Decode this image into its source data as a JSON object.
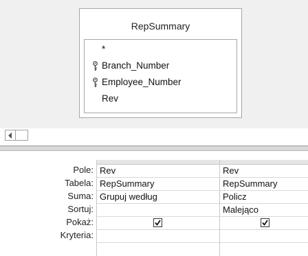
{
  "table": {
    "name": "RepSummary",
    "fields": [
      {
        "name": "*",
        "key": false
      },
      {
        "name": "Branch_Number",
        "key": true
      },
      {
        "name": "Employee_Number",
        "key": true
      },
      {
        "name": "Rev",
        "key": false
      }
    ]
  },
  "grid": {
    "row_labels": [
      "Pole:",
      "Tabela:",
      "Suma:",
      "Sortuj:",
      "Pokaż:",
      "Kryteria:"
    ],
    "columns": [
      {
        "field": "Rev",
        "table": "RepSummary",
        "total": "Grupuj według",
        "sort": "",
        "show": true,
        "criteria": ""
      },
      {
        "field": "Rev",
        "table": "RepSummary",
        "total": "Policz",
        "sort": "Malejąco",
        "show": true,
        "criteria": ""
      }
    ]
  },
  "icons": {
    "key": "key-icon",
    "scroll_left": "chevron-left-icon",
    "check": "checkmark-icon"
  },
  "colors": {
    "pane_background": "#f0f0f0",
    "border": "#a6a6a6"
  }
}
